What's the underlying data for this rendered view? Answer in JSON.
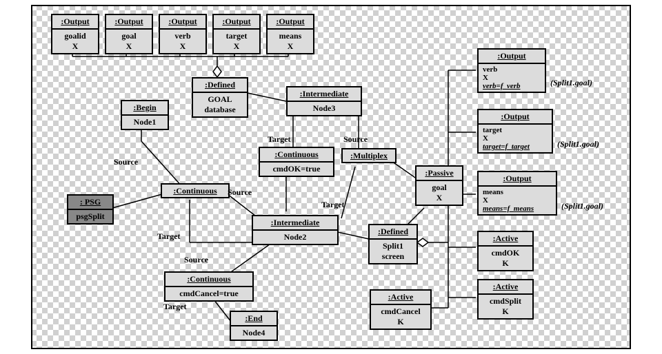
{
  "outputs_top": [
    {
      "h": ":Output",
      "a": "goalid",
      "b": "X"
    },
    {
      "h": ":Output",
      "a": "goal",
      "b": "X"
    },
    {
      "h": ":Output",
      "a": "verb",
      "b": "X"
    },
    {
      "h": ":Output",
      "a": "target",
      "b": "X"
    },
    {
      "h": ":Output",
      "a": "means",
      "b": "X"
    }
  ],
  "outputs_right": [
    {
      "h": ":Output",
      "a": "verb",
      "b": "X",
      "c": "verb=f_verb",
      "ann": "(Split1.goal)"
    },
    {
      "h": ":Output",
      "a": "target",
      "b": "X",
      "c": "target=f_target",
      "ann": "(Split1.goal)"
    },
    {
      "h": ":Output",
      "a": "means",
      "b": "X",
      "c": "means=f_means",
      "ann": "(Split1.goal)"
    }
  ],
  "begin": {
    "h": ":Begin",
    "a": "Node1"
  },
  "defined_goal": {
    "h": ":Defined",
    "a": "GOAL",
    "b": "database"
  },
  "intermediate3": {
    "h": ":Intermediate",
    "a": "Node3"
  },
  "psg": {
    "h": ": PSG",
    "a": "psgSplit"
  },
  "continuous": {
    "h": ":Continuous"
  },
  "continuous_ok": {
    "h": ":Continuous",
    "a": "cmdOK=true"
  },
  "multiplex": {
    "h": ":Multiplex"
  },
  "passive": {
    "h": ":Passive",
    "a": "goal",
    "b": "X"
  },
  "intermediate2": {
    "h": ":Intermediate",
    "a": "Node2"
  },
  "defined_split": {
    "h": ":Defined",
    "a": "Split1",
    "b": "screen"
  },
  "continuous_cancel": {
    "h": ":Continuous",
    "a": "cmdCancel=true"
  },
  "end": {
    "h": ":End",
    "a": "Node4"
  },
  "active_ok": {
    "h": ":Active",
    "a": "cmdOK",
    "b": "K"
  },
  "active_cancel": {
    "h": ":Active",
    "a": "cmdCancel",
    "b": "K"
  },
  "active_split": {
    "h": ":Active",
    "a": "cmdSplit",
    "b": "K"
  },
  "labels": {
    "source": "Source",
    "target": "Target"
  }
}
